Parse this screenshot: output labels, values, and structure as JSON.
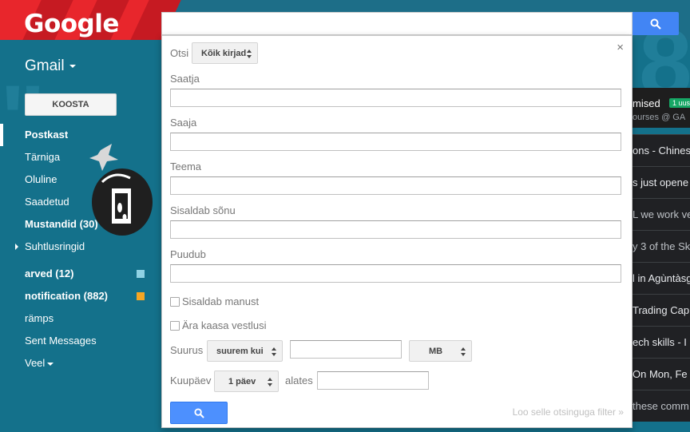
{
  "app": {
    "logo_text": "Google",
    "product_label": "Gmail"
  },
  "nav": {
    "compose_label": "KOOSTA",
    "items": [
      {
        "label": "Postkast",
        "style": "active"
      },
      {
        "label": "Tärniga",
        "style": "normal"
      },
      {
        "label": "Oluline",
        "style": "normal"
      },
      {
        "label": "Saadetud",
        "style": "normal"
      },
      {
        "label": "Mustandid (30)",
        "style": "bold"
      },
      {
        "label": "Suhtlusringid",
        "style": "expandable"
      },
      {
        "label": "arved (12)",
        "style": "bold",
        "color": "#8fd2e4"
      },
      {
        "label": "notification (882)",
        "style": "bold",
        "color": "#f6a623"
      },
      {
        "label": "rämps",
        "style": "normal"
      },
      {
        "label": "Sent Messages",
        "style": "normal"
      },
      {
        "label": "Veel",
        "style": "more"
      }
    ]
  },
  "search_panel": {
    "scope_label": "Otsi",
    "scope_value": "Kõik kirjad",
    "fields": [
      {
        "label": "Saatja",
        "value": ""
      },
      {
        "label": "Saaja",
        "value": ""
      },
      {
        "label": "Teema",
        "value": ""
      },
      {
        "label": "Sisaldab sõnu",
        "value": ""
      },
      {
        "label": "Puudub",
        "value": ""
      }
    ],
    "has_attachment_label": "Sisaldab manust",
    "exclude_chats_label": "Ära kaasa vestlusi",
    "size_label": "Suurus",
    "size_operator": "suurem kui",
    "size_value": "",
    "size_unit": "MB",
    "date_label": "Kuupäev",
    "date_range": "1 päev",
    "date_from_label": "alates",
    "date_value": "",
    "create_filter_link": "Loo selle otsinguga filter »",
    "close_symbol": "×"
  },
  "mail_list": {
    "tab_title": "mised",
    "tab_subtitle": "ourses @ GA",
    "new_badge": "1 uus",
    "rows": [
      {
        "snippet": "ons - Chines",
        "read": false
      },
      {
        "snippet": "s just opene",
        "read": false
      },
      {
        "snippet": "L we work ve",
        "read": true
      },
      {
        "snippet": "y 3 of the Sk",
        "read": true
      },
      {
        "snippet": "l in Agùntàsg",
        "read": false
      },
      {
        "snippet": "Trading Cap",
        "read": false
      },
      {
        "snippet": "ech skills - I",
        "read": false
      },
      {
        "snippet": "On Mon, Fe",
        "read": false
      },
      {
        "snippet": "these comm",
        "read": true
      }
    ]
  },
  "colors": {
    "search_blue": "#4285f4",
    "panel_button_blue": "#4d90fe",
    "theme_red": "#e8262c",
    "theme_teal": "#14718b"
  },
  "icons": {
    "search": "magnifier-icon",
    "close": "close-icon"
  }
}
